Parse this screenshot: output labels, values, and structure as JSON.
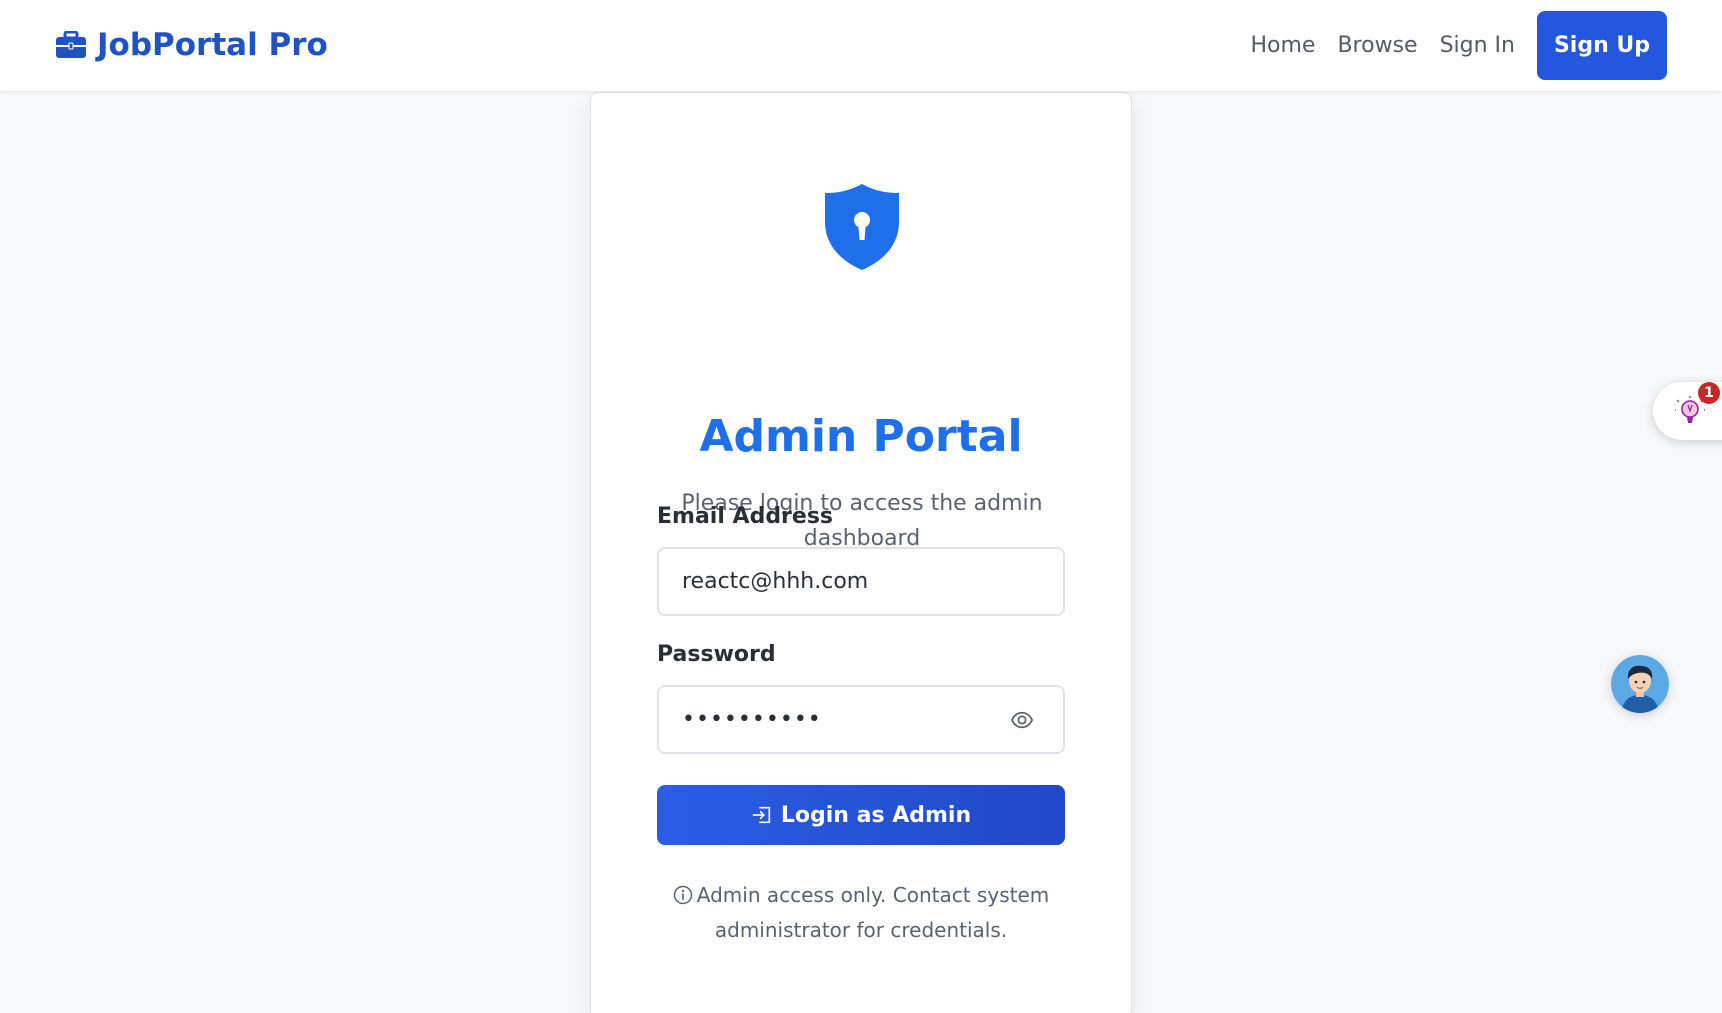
{
  "navbar": {
    "brand": "JobPortal Pro",
    "links": [
      "Home",
      "Browse",
      "Sign In"
    ],
    "signup_label": "Sign Up"
  },
  "login_card": {
    "title": "Admin Portal",
    "subtitle": "Please login to access the admin dashboard",
    "email_label": "Email Address",
    "email_value": "reactc@hhh.com",
    "password_label": "Password",
    "password_value": "••••••••••",
    "submit_label": "Login as Admin",
    "note": "Admin access only. Contact system administrator for credentials."
  },
  "widgets": {
    "notification_count": "1"
  },
  "colors": {
    "brand": "#2152c4",
    "accent": "#1f6feb",
    "button": "#2457dd",
    "badge": "#c62828"
  }
}
